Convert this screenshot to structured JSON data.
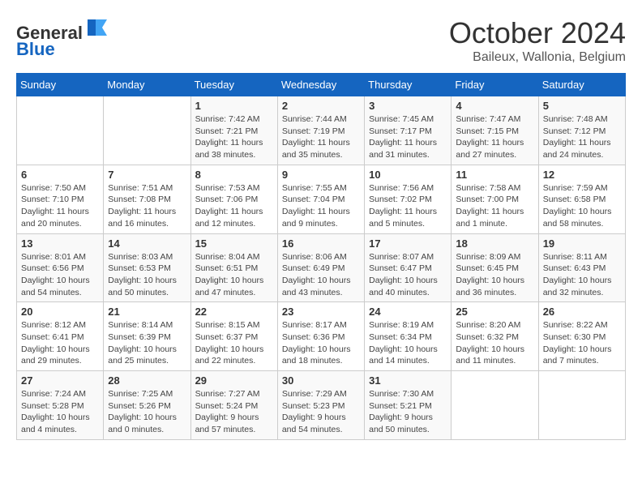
{
  "header": {
    "logo_line1": "General",
    "logo_line2": "Blue",
    "month": "October 2024",
    "location": "Baileux, Wallonia, Belgium"
  },
  "weekdays": [
    "Sunday",
    "Monday",
    "Tuesday",
    "Wednesday",
    "Thursday",
    "Friday",
    "Saturday"
  ],
  "weeks": [
    [
      {
        "day": "",
        "info": ""
      },
      {
        "day": "",
        "info": ""
      },
      {
        "day": "1",
        "info": "Sunrise: 7:42 AM\nSunset: 7:21 PM\nDaylight: 11 hours and 38 minutes."
      },
      {
        "day": "2",
        "info": "Sunrise: 7:44 AM\nSunset: 7:19 PM\nDaylight: 11 hours and 35 minutes."
      },
      {
        "day": "3",
        "info": "Sunrise: 7:45 AM\nSunset: 7:17 PM\nDaylight: 11 hours and 31 minutes."
      },
      {
        "day": "4",
        "info": "Sunrise: 7:47 AM\nSunset: 7:15 PM\nDaylight: 11 hours and 27 minutes."
      },
      {
        "day": "5",
        "info": "Sunrise: 7:48 AM\nSunset: 7:12 PM\nDaylight: 11 hours and 24 minutes."
      }
    ],
    [
      {
        "day": "6",
        "info": "Sunrise: 7:50 AM\nSunset: 7:10 PM\nDaylight: 11 hours and 20 minutes."
      },
      {
        "day": "7",
        "info": "Sunrise: 7:51 AM\nSunset: 7:08 PM\nDaylight: 11 hours and 16 minutes."
      },
      {
        "day": "8",
        "info": "Sunrise: 7:53 AM\nSunset: 7:06 PM\nDaylight: 11 hours and 12 minutes."
      },
      {
        "day": "9",
        "info": "Sunrise: 7:55 AM\nSunset: 7:04 PM\nDaylight: 11 hours and 9 minutes."
      },
      {
        "day": "10",
        "info": "Sunrise: 7:56 AM\nSunset: 7:02 PM\nDaylight: 11 hours and 5 minutes."
      },
      {
        "day": "11",
        "info": "Sunrise: 7:58 AM\nSunset: 7:00 PM\nDaylight: 11 hours and 1 minute."
      },
      {
        "day": "12",
        "info": "Sunrise: 7:59 AM\nSunset: 6:58 PM\nDaylight: 10 hours and 58 minutes."
      }
    ],
    [
      {
        "day": "13",
        "info": "Sunrise: 8:01 AM\nSunset: 6:56 PM\nDaylight: 10 hours and 54 minutes."
      },
      {
        "day": "14",
        "info": "Sunrise: 8:03 AM\nSunset: 6:53 PM\nDaylight: 10 hours and 50 minutes."
      },
      {
        "day": "15",
        "info": "Sunrise: 8:04 AM\nSunset: 6:51 PM\nDaylight: 10 hours and 47 minutes."
      },
      {
        "day": "16",
        "info": "Sunrise: 8:06 AM\nSunset: 6:49 PM\nDaylight: 10 hours and 43 minutes."
      },
      {
        "day": "17",
        "info": "Sunrise: 8:07 AM\nSunset: 6:47 PM\nDaylight: 10 hours and 40 minutes."
      },
      {
        "day": "18",
        "info": "Sunrise: 8:09 AM\nSunset: 6:45 PM\nDaylight: 10 hours and 36 minutes."
      },
      {
        "day": "19",
        "info": "Sunrise: 8:11 AM\nSunset: 6:43 PM\nDaylight: 10 hours and 32 minutes."
      }
    ],
    [
      {
        "day": "20",
        "info": "Sunrise: 8:12 AM\nSunset: 6:41 PM\nDaylight: 10 hours and 29 minutes."
      },
      {
        "day": "21",
        "info": "Sunrise: 8:14 AM\nSunset: 6:39 PM\nDaylight: 10 hours and 25 minutes."
      },
      {
        "day": "22",
        "info": "Sunrise: 8:15 AM\nSunset: 6:37 PM\nDaylight: 10 hours and 22 minutes."
      },
      {
        "day": "23",
        "info": "Sunrise: 8:17 AM\nSunset: 6:36 PM\nDaylight: 10 hours and 18 minutes."
      },
      {
        "day": "24",
        "info": "Sunrise: 8:19 AM\nSunset: 6:34 PM\nDaylight: 10 hours and 14 minutes."
      },
      {
        "day": "25",
        "info": "Sunrise: 8:20 AM\nSunset: 6:32 PM\nDaylight: 10 hours and 11 minutes."
      },
      {
        "day": "26",
        "info": "Sunrise: 8:22 AM\nSunset: 6:30 PM\nDaylight: 10 hours and 7 minutes."
      }
    ],
    [
      {
        "day": "27",
        "info": "Sunrise: 7:24 AM\nSunset: 5:28 PM\nDaylight: 10 hours and 4 minutes."
      },
      {
        "day": "28",
        "info": "Sunrise: 7:25 AM\nSunset: 5:26 PM\nDaylight: 10 hours and 0 minutes."
      },
      {
        "day": "29",
        "info": "Sunrise: 7:27 AM\nSunset: 5:24 PM\nDaylight: 9 hours and 57 minutes."
      },
      {
        "day": "30",
        "info": "Sunrise: 7:29 AM\nSunset: 5:23 PM\nDaylight: 9 hours and 54 minutes."
      },
      {
        "day": "31",
        "info": "Sunrise: 7:30 AM\nSunset: 5:21 PM\nDaylight: 9 hours and 50 minutes."
      },
      {
        "day": "",
        "info": ""
      },
      {
        "day": "",
        "info": ""
      }
    ]
  ]
}
